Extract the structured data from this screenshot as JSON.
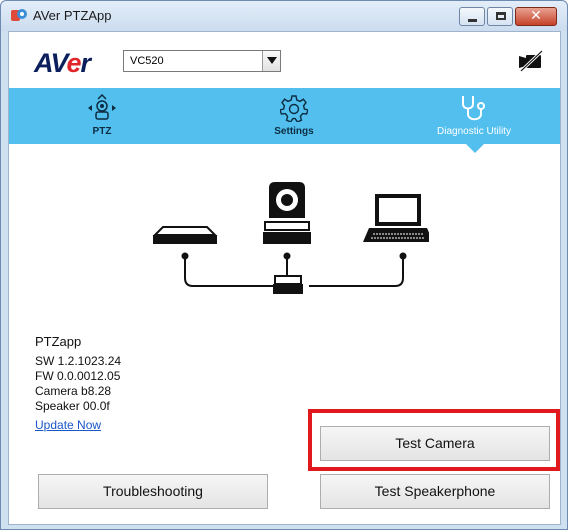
{
  "window": {
    "title": "AVer PTZApp",
    "close_glyph": "✕"
  },
  "header": {
    "logo_prefix": "AV",
    "logo_accent": "e",
    "logo_suffix": "r",
    "device": {
      "selected": "VC520"
    },
    "camera_status_icon": "camera-off-icon"
  },
  "tabs": [
    {
      "label": "PTZ",
      "icon": "ptz-joystick-icon",
      "active": false
    },
    {
      "label": "Settings",
      "icon": "gear-icon",
      "active": false
    },
    {
      "label": "Diagnostic Utility",
      "icon": "stethoscope-icon",
      "active": true
    }
  ],
  "info": {
    "app_name": "PTZapp",
    "sw": "SW 1.2.1023.24",
    "fw": "FW 0.0.0012.05",
    "camera": "Camera b8.28",
    "speaker": "Speaker 00.0f",
    "update_link": "Update Now"
  },
  "buttons": {
    "test_camera": "Test Camera",
    "troubleshooting": "Troubleshooting",
    "test_speakerphone": "Test Speakerphone"
  },
  "colors": {
    "tab_bar": "#52bfef",
    "logo_blue": "#0a1f5c",
    "logo_red": "#e0262b",
    "highlight": "#e0191e",
    "link": "#1a56c7"
  }
}
